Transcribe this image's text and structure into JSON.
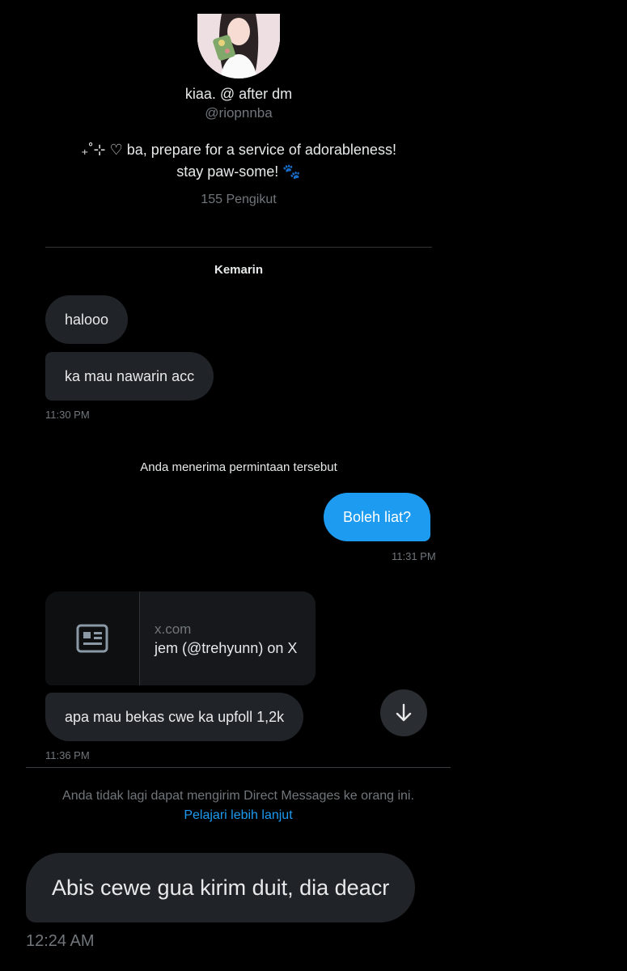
{
  "profile": {
    "name": "kiaa. @ after dm",
    "handle": "@riopnnba",
    "bio_line1": "₊˚⊹ ♡ ba, prepare for a service of adorableness!",
    "bio_line2": "stay paw-some! 🐾",
    "followers": "155 Pengikut"
  },
  "conversation": {
    "day_label": "Kemarin",
    "messages_group1": [
      {
        "text": "halooo"
      },
      {
        "text": "ka mau nawarin acc"
      }
    ],
    "time1": "11:30 PM",
    "accepted_notice": "Anda menerima permintaan tersebut",
    "outgoing": {
      "text": "Boleh liat?"
    },
    "time2": "11:31 PM",
    "link_card": {
      "icon": "article-icon",
      "domain": "x.com",
      "title": "jem (@trehyunn) on X"
    },
    "message3": {
      "text": "apa mau bekas cwe ka upfoll 1,2k"
    },
    "time3": "11:36 PM",
    "blocked_notice": "Anda tidak lagi dapat mengirim Direct Messages ke orang ini.",
    "learn_more": "Pelajari lebih lanjut"
  },
  "caption": {
    "text": "Abis cewe gua kirim duit, dia deacr",
    "time": "12:24 AM"
  },
  "colors": {
    "background": "#000000",
    "bubble_in": "#202327",
    "bubble_out": "#1d9bf0",
    "muted": "#71767b",
    "link": "#1d9bf0"
  }
}
